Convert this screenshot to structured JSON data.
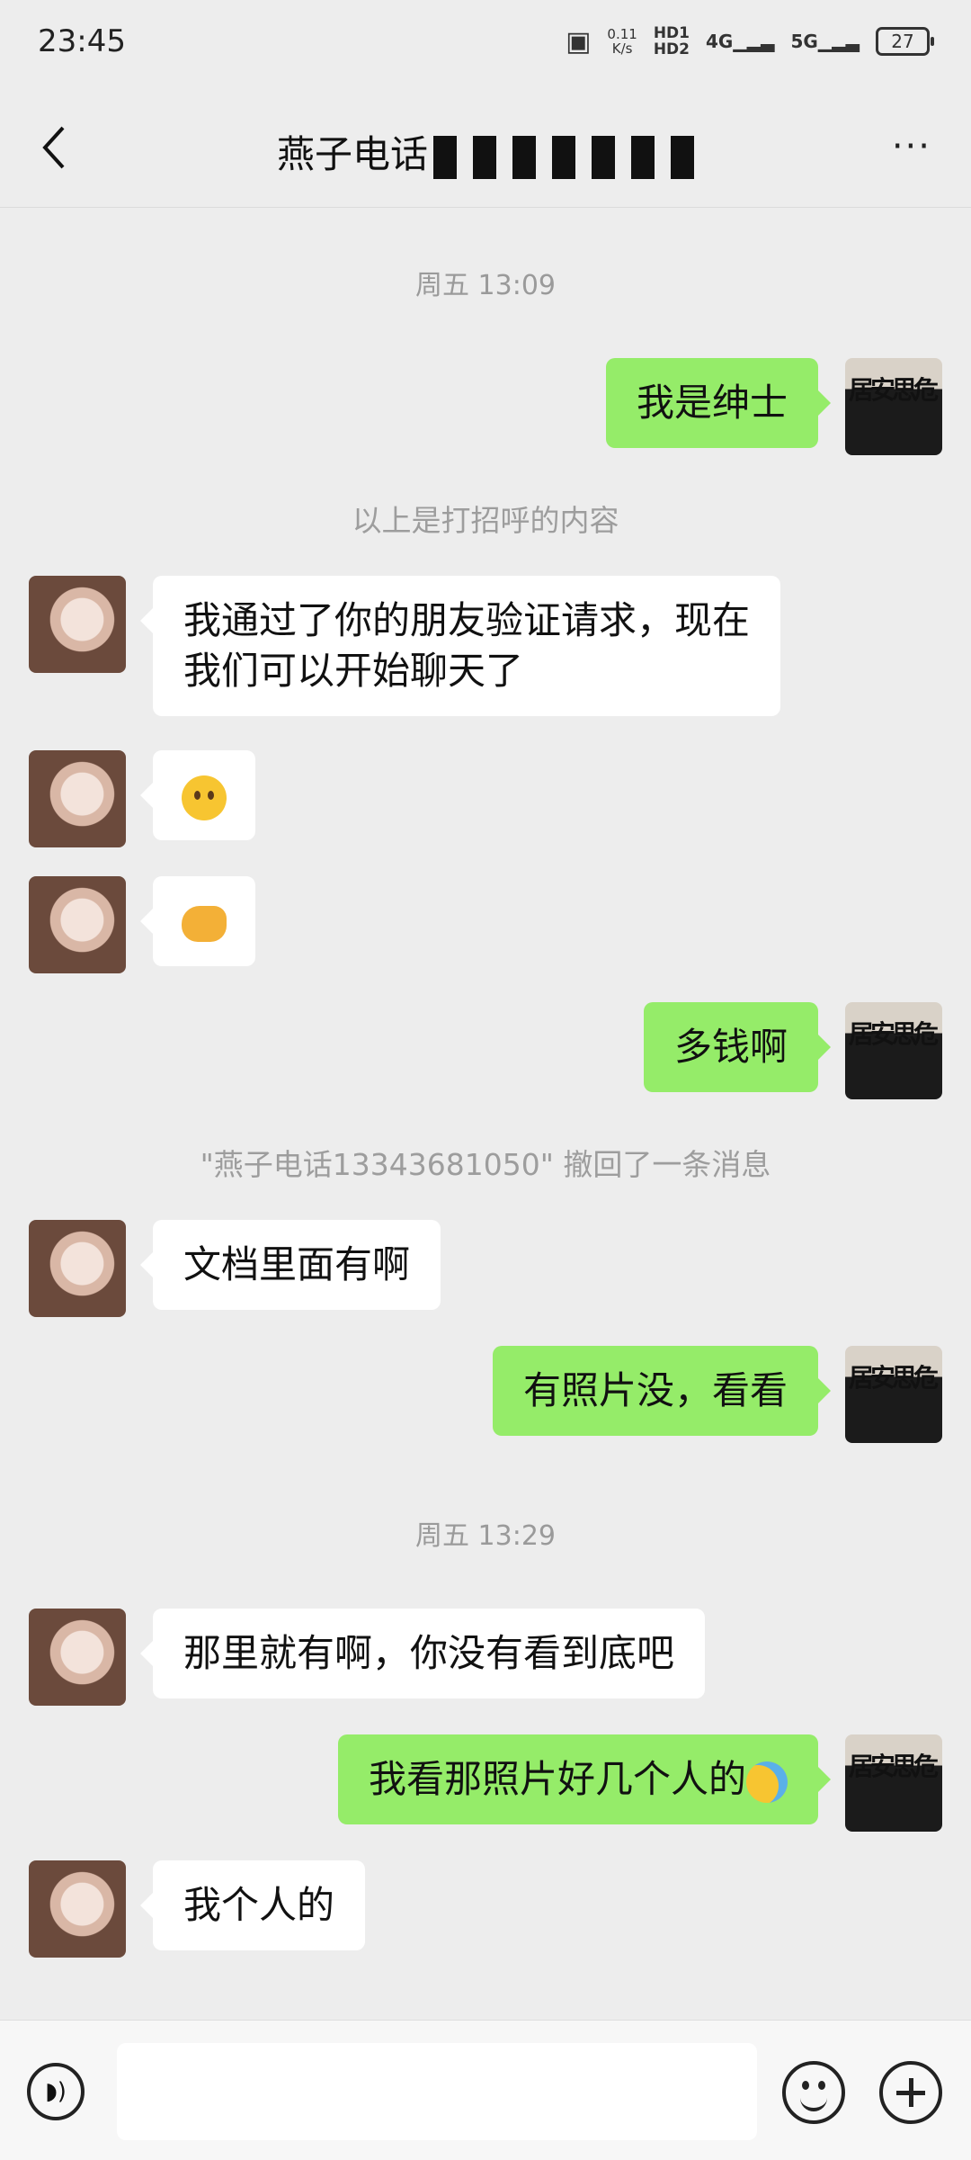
{
  "status_bar": {
    "time": "23:45",
    "net_speed": "0.11",
    "net_unit": "K/s",
    "hd1": "HD1",
    "hd2": "HD2",
    "sig1": "4G",
    "sig2": "5G",
    "battery": "27"
  },
  "header": {
    "title": "燕子电话",
    "more_label": "···"
  },
  "messages": {
    "ts1": "周五 13:09",
    "m1": "我是绅士",
    "sys1": "以上是打招呼的内容",
    "m2_line1": "我通过了你的朋友验证请求，现在",
    "m2_line2": "我们可以开始聊天了",
    "m5": "多钱啊",
    "sys2": "\"燕子电话13343681050\" 撤回了一条消息",
    "m6": "文档里面有啊",
    "m7": "有照片没，看看",
    "ts2": "周五 13:29",
    "m8": "那里就有啊，你没有看到底吧",
    "m9": "我看那照片好几个人的",
    "m10": "我个人的"
  },
  "avatar_me_text": "居安思危",
  "input": {
    "value": ""
  },
  "colors": {
    "bubble_me": "#95ec69",
    "bubble_her": "#ffffff",
    "background": "#ededed"
  }
}
